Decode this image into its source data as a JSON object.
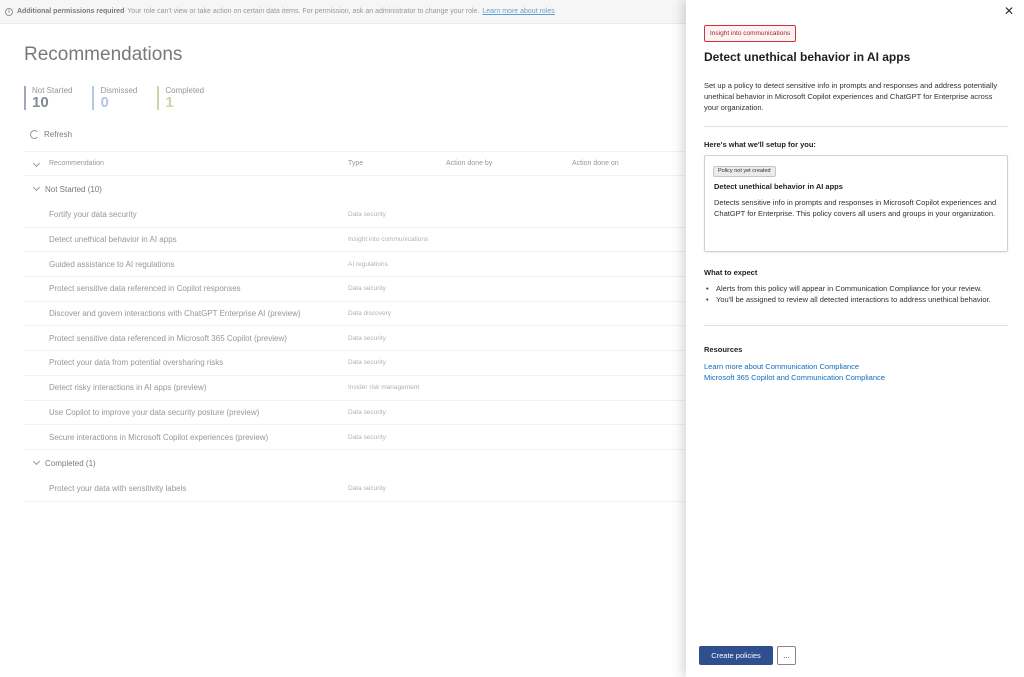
{
  "banner": {
    "bold": "Additional permissions required",
    "text": "Your role can't view or take action on certain data items. For permission, ask an administrator to change your role.",
    "link": "Learn more about roles"
  },
  "page": {
    "title": "Recommendations"
  },
  "stats": [
    {
      "label": "Not Started",
      "value": "10"
    },
    {
      "label": "Dismissed",
      "value": "0"
    },
    {
      "label": "Completed",
      "value": "1"
    }
  ],
  "toolbar": {
    "refresh": "Refresh"
  },
  "table": {
    "headers": {
      "recommendation": "Recommendation",
      "type": "Type",
      "by": "Action done by",
      "on": "Action done on"
    },
    "groups": [
      {
        "label": "Not Started (10)",
        "rows": [
          {
            "name": "Fortify your data security",
            "type": "Data security"
          },
          {
            "name": "Detect unethical behavior in AI apps",
            "type": "Insight into communications"
          },
          {
            "name": "Guided assistance to AI regulations",
            "type": "AI regulations"
          },
          {
            "name": "Protect sensitive data referenced in Copilot responses",
            "type": "Data security"
          },
          {
            "name": "Discover and govern interactions with ChatGPT Enterprise AI (preview)",
            "type": "Data discovery"
          },
          {
            "name": "Protect sensitive data referenced in Microsoft 365 Copilot (preview)",
            "type": "Data security"
          },
          {
            "name": "Protect your data from potential oversharing risks",
            "type": "Data security"
          },
          {
            "name": "Detect risky interactions in AI apps (preview)",
            "type": "Insider risk management"
          },
          {
            "name": "Use Copilot to improve your data security posture (preview)",
            "type": "Data security"
          },
          {
            "name": "Secure interactions in Microsoft Copilot experiences (preview)",
            "type": "Data security"
          }
        ]
      },
      {
        "label": "Completed (1)",
        "rows": [
          {
            "name": "Protect your data with sensitivity labels",
            "type": "Data security"
          }
        ]
      }
    ]
  },
  "panel": {
    "tag": "Insight into communications",
    "title": "Detect unethical behavior in AI apps",
    "description": "Set up a policy to detect sensitive info in prompts and responses and address potentially unethical behavior in Microsoft Copilot experiences and ChatGPT for Enterprise across your organization.",
    "setup_title": "Here's what we'll setup for you:",
    "card": {
      "status": "Policy not yet created",
      "title": "Detect unethical behavior in AI apps",
      "description": "Detects sensitive info in prompts and responses in Microsoft Copilot experiences and ChatGPT for Enterprise. This policy covers all users and groups in your organization."
    },
    "expect_title": "What to expect",
    "expect_items": [
      "Alerts from this policy will appear in Communication Compliance for your review.",
      "You'll be assigned to review all detected interactions to address unethical behavior."
    ],
    "resources_title": "Resources",
    "resources": [
      "Learn more about Communication Compliance",
      "Microsoft 365 Copilot and Communication Compliance"
    ],
    "primary_button": "Create policies",
    "more_button": "..."
  }
}
